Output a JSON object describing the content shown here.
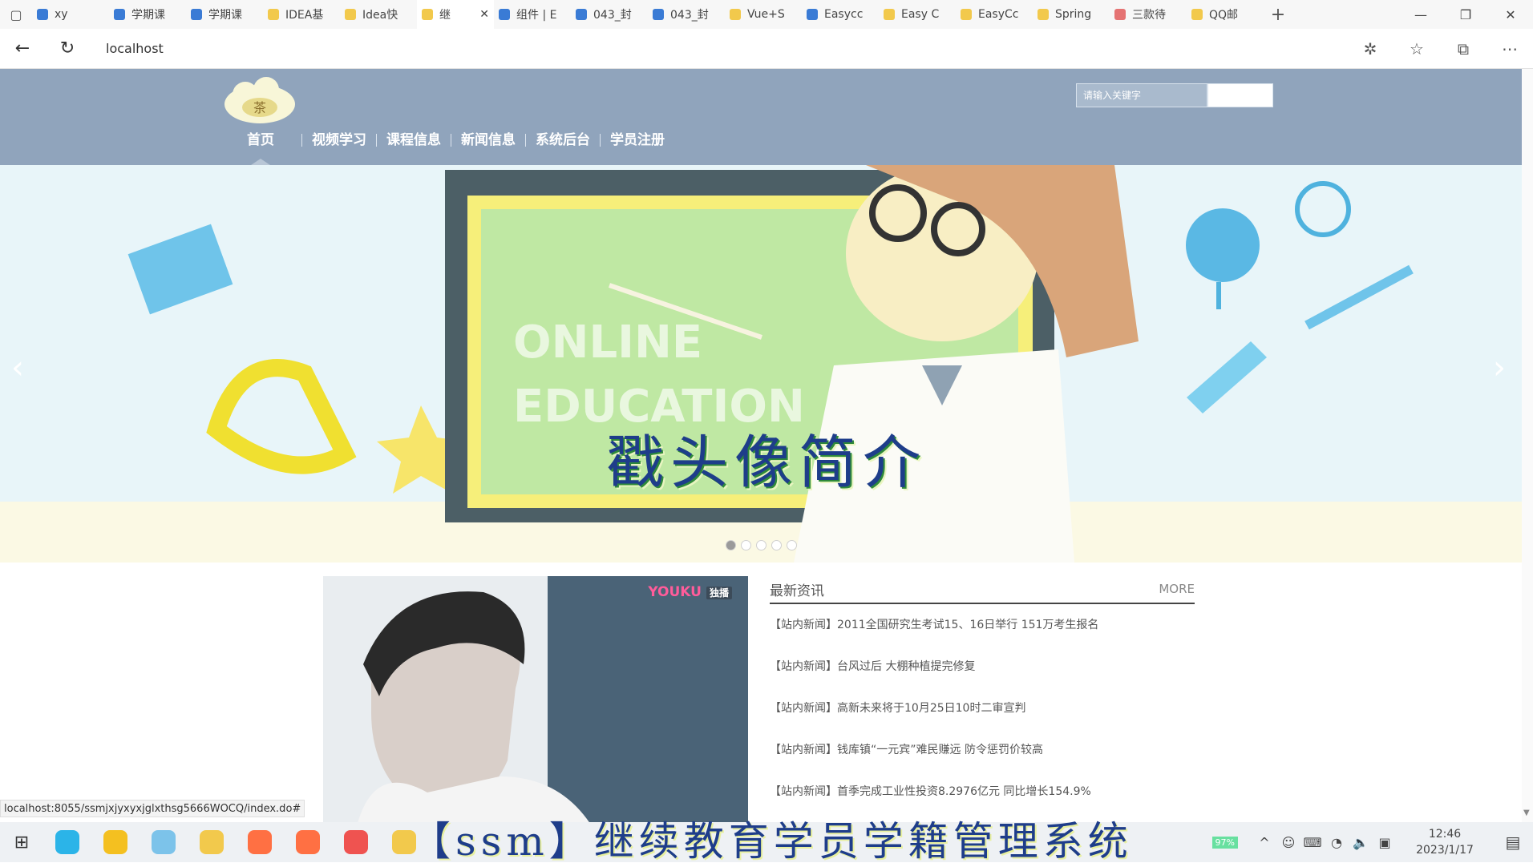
{
  "browser": {
    "tabs": [
      {
        "label": "xy",
        "color": "#3a7bd5"
      },
      {
        "label": "学期课",
        "color": "#3a7bd5"
      },
      {
        "label": "学期课",
        "color": "#3a7bd5"
      },
      {
        "label": "IDEA基",
        "color": "#f2c94c"
      },
      {
        "label": "Idea快",
        "color": "#f2c94c"
      },
      {
        "label": "继",
        "color": "#f2c94c",
        "active": true
      },
      {
        "label": "组件 | E",
        "color": "#3a7bd5"
      },
      {
        "label": "043_封",
        "color": "#3a7bd5"
      },
      {
        "label": "043_封",
        "color": "#3a7bd5"
      },
      {
        "label": "Vue+S",
        "color": "#f2c94c"
      },
      {
        "label": "Easycc",
        "color": "#3a7bd5"
      },
      {
        "label": "Easy C",
        "color": "#f2c94c"
      },
      {
        "label": "EasyCc",
        "color": "#f2c94c"
      },
      {
        "label": "Spring",
        "color": "#f2c94c"
      },
      {
        "label": "三款待",
        "color": "#e57373"
      },
      {
        "label": "QQ邮",
        "color": "#f2c94c"
      }
    ],
    "tab_close": "✕",
    "new_tab": "+",
    "url": "localhost",
    "status_url": "localhost:8055/ssmjxjyxyxjglxthsg5666WOCQ/index.do#"
  },
  "site": {
    "nav": [
      "首页",
      "视频学习",
      "课程信息",
      "新闻信息",
      "系统后台",
      "学员注册"
    ],
    "logo_text": "茶",
    "search_placeholder": "请输入关键字"
  },
  "banner": {
    "board_text_1": "ONLINE",
    "board_text_2": "EDUCATION",
    "overlay_title": "戳头像简介",
    "slide_count": 5,
    "active_slide": 0
  },
  "video": {
    "brand": "YOUKU",
    "tag": "独播"
  },
  "news": {
    "title": "最新资讯",
    "more": "MORE",
    "items": [
      "【站内新闻】2011全国研究生考试15、16日举行 151万考生报名",
      "【站内新闻】台风过后 大棚种植提完修复",
      "【站内新闻】高新未来将于10月25日10时二审宣判",
      "【站内新闻】钱库镇“一元宾”难民赚远 防令惩罚价较高",
      "【站内新闻】首季完成工业性投资8.2976亿元 同比增长154.9%"
    ]
  },
  "caption": "【ssm】继续教育学员学籍管理系统",
  "taskbar": {
    "battery": "97%",
    "time": "12:46",
    "date": "2023/1/17",
    "apps": [
      "#2bb4e8",
      "#f4c020",
      "#7cc3ea",
      "#f2c94c",
      "#ff7043",
      "#ff7043",
      "#ef5350",
      "#f2c94c"
    ]
  }
}
